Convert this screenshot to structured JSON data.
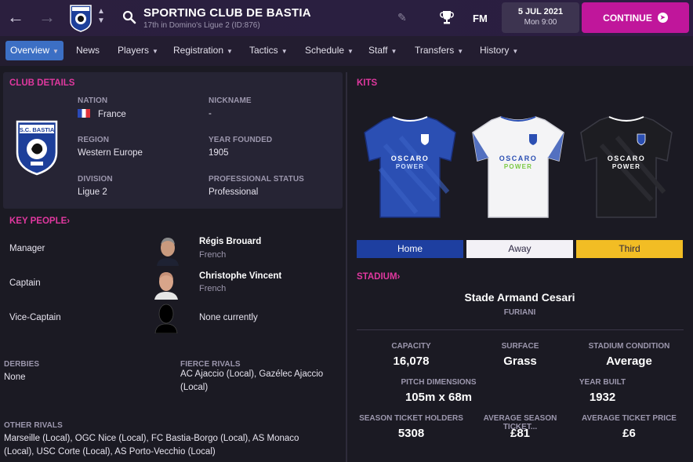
{
  "header": {
    "back_icon": "arrow-left-icon",
    "forward_icon": "arrow-right-icon",
    "club_name": "SPORTING CLUB DE BASTIA",
    "club_subtitle": "17th in Domino's Ligue 2 (ID:876)",
    "fm_label": "FM",
    "date": "5 JUL 2021",
    "time": "Mon 9:00",
    "continue_label": "CONTINUE",
    "accent_color": "#c0169b"
  },
  "tabs": [
    {
      "label": "Overview",
      "active": true
    },
    {
      "label": "News"
    },
    {
      "label": "Players"
    },
    {
      "label": "Registration"
    },
    {
      "label": "Tactics"
    },
    {
      "label": "Schedule"
    },
    {
      "label": "Staff"
    },
    {
      "label": "Transfers"
    },
    {
      "label": "History"
    }
  ],
  "club_details": {
    "title": "CLUB DETAILS",
    "crest_text": "S.C. BASTIA",
    "nation_label": "NATION",
    "nation": "France",
    "nickname_label": "NICKNAME",
    "nickname": "-",
    "region_label": "REGION",
    "region": "Western Europe",
    "year_founded_label": "YEAR FOUNDED",
    "year_founded": "1905",
    "division_label": "DIVISION",
    "division": "Ligue 2",
    "status_label": "PROFESSIONAL STATUS",
    "status": "Professional"
  },
  "key_people": {
    "title": "KEY PEOPLE",
    "rows": [
      {
        "role": "Manager",
        "name": "Régis Brouard",
        "nationality": "French"
      },
      {
        "role": "Captain",
        "name": "Christophe Vincent",
        "nationality": "French"
      },
      {
        "role": "Vice-Captain",
        "name": "None currently",
        "nationality": ""
      }
    ]
  },
  "rivals": {
    "derbies_label": "DERBIES",
    "derbies": "None",
    "fierce_label": "FIERCE RIVALS",
    "fierce_line1": "AC Ajaccio (Local), Gazélec Ajaccio",
    "fierce_line2": "(Local)",
    "other_label": "OTHER RIVALS",
    "other_line1": "Marseille (Local), OGC Nice (Local), FC Bastia-Borgo (Local), AS Monaco",
    "other_line2": "(Local), USC Corte (Local), AS Porto-Vecchio (Local)"
  },
  "kits": {
    "title": "KITS",
    "sponsor_line1": "OSCARO",
    "sponsor_line2": "POWER",
    "buttons": [
      {
        "label": "Home",
        "color": "#1e3fa0",
        "text_color": "#ffffff"
      },
      {
        "label": "Away",
        "color": "#f3f1f6",
        "text_color": "#2a2540"
      },
      {
        "label": "Third",
        "color": "#f2bd24",
        "text_color": "#2a2540"
      }
    ]
  },
  "stadium": {
    "title": "STADIUM",
    "name": "Stade Armand Cesari",
    "location": "FURIANI",
    "capacity_label": "CAPACITY",
    "capacity": "16,078",
    "surface_label": "SURFACE",
    "surface": "Grass",
    "condition_label": "STADIUM CONDITION",
    "condition": "Average",
    "pitch_label": "PITCH DIMENSIONS",
    "pitch": "105m x 68m",
    "year_built_label": "YEAR BUILT",
    "year_built": "1932",
    "season_holders_label": "SEASON TICKET HOLDERS",
    "season_holders": "5308",
    "avg_season_label": "AVERAGE SEASON TICKET...",
    "avg_season": "£81",
    "avg_ticket_label": "AVERAGE TICKET PRICE",
    "avg_ticket": "£6"
  }
}
